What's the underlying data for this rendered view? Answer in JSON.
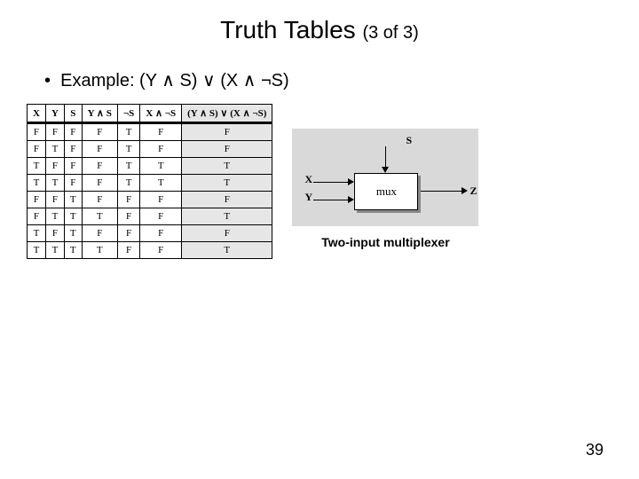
{
  "title_main": "Truth Tables ",
  "title_sub": "(3 of 3)",
  "bullet_text": "Example: (Y ∧ S) ∨ (X ∧ ¬S)",
  "table": {
    "headers": [
      "X",
      "Y",
      "S",
      "Y ∧ S",
      "¬S",
      "X ∧ ¬S",
      "(Y ∧ S) ∨ (X ∧ ¬S)"
    ],
    "rows": [
      [
        "F",
        "F",
        "F",
        "F",
        "T",
        "F",
        "F"
      ],
      [
        "F",
        "T",
        "F",
        "F",
        "T",
        "F",
        "F"
      ],
      [
        "T",
        "F",
        "F",
        "F",
        "T",
        "T",
        "T"
      ],
      [
        "T",
        "T",
        "F",
        "F",
        "T",
        "T",
        "T"
      ],
      [
        "F",
        "F",
        "T",
        "F",
        "F",
        "F",
        "F"
      ],
      [
        "F",
        "T",
        "T",
        "T",
        "F",
        "F",
        "T"
      ],
      [
        "T",
        "F",
        "T",
        "F",
        "F",
        "F",
        "F"
      ],
      [
        "T",
        "T",
        "T",
        "T",
        "F",
        "F",
        "T"
      ]
    ]
  },
  "mux": {
    "s": "S",
    "x": "X",
    "y": "Y",
    "z": "Z",
    "box": "mux",
    "caption": "Two-input multiplexer"
  },
  "page_number": "39"
}
